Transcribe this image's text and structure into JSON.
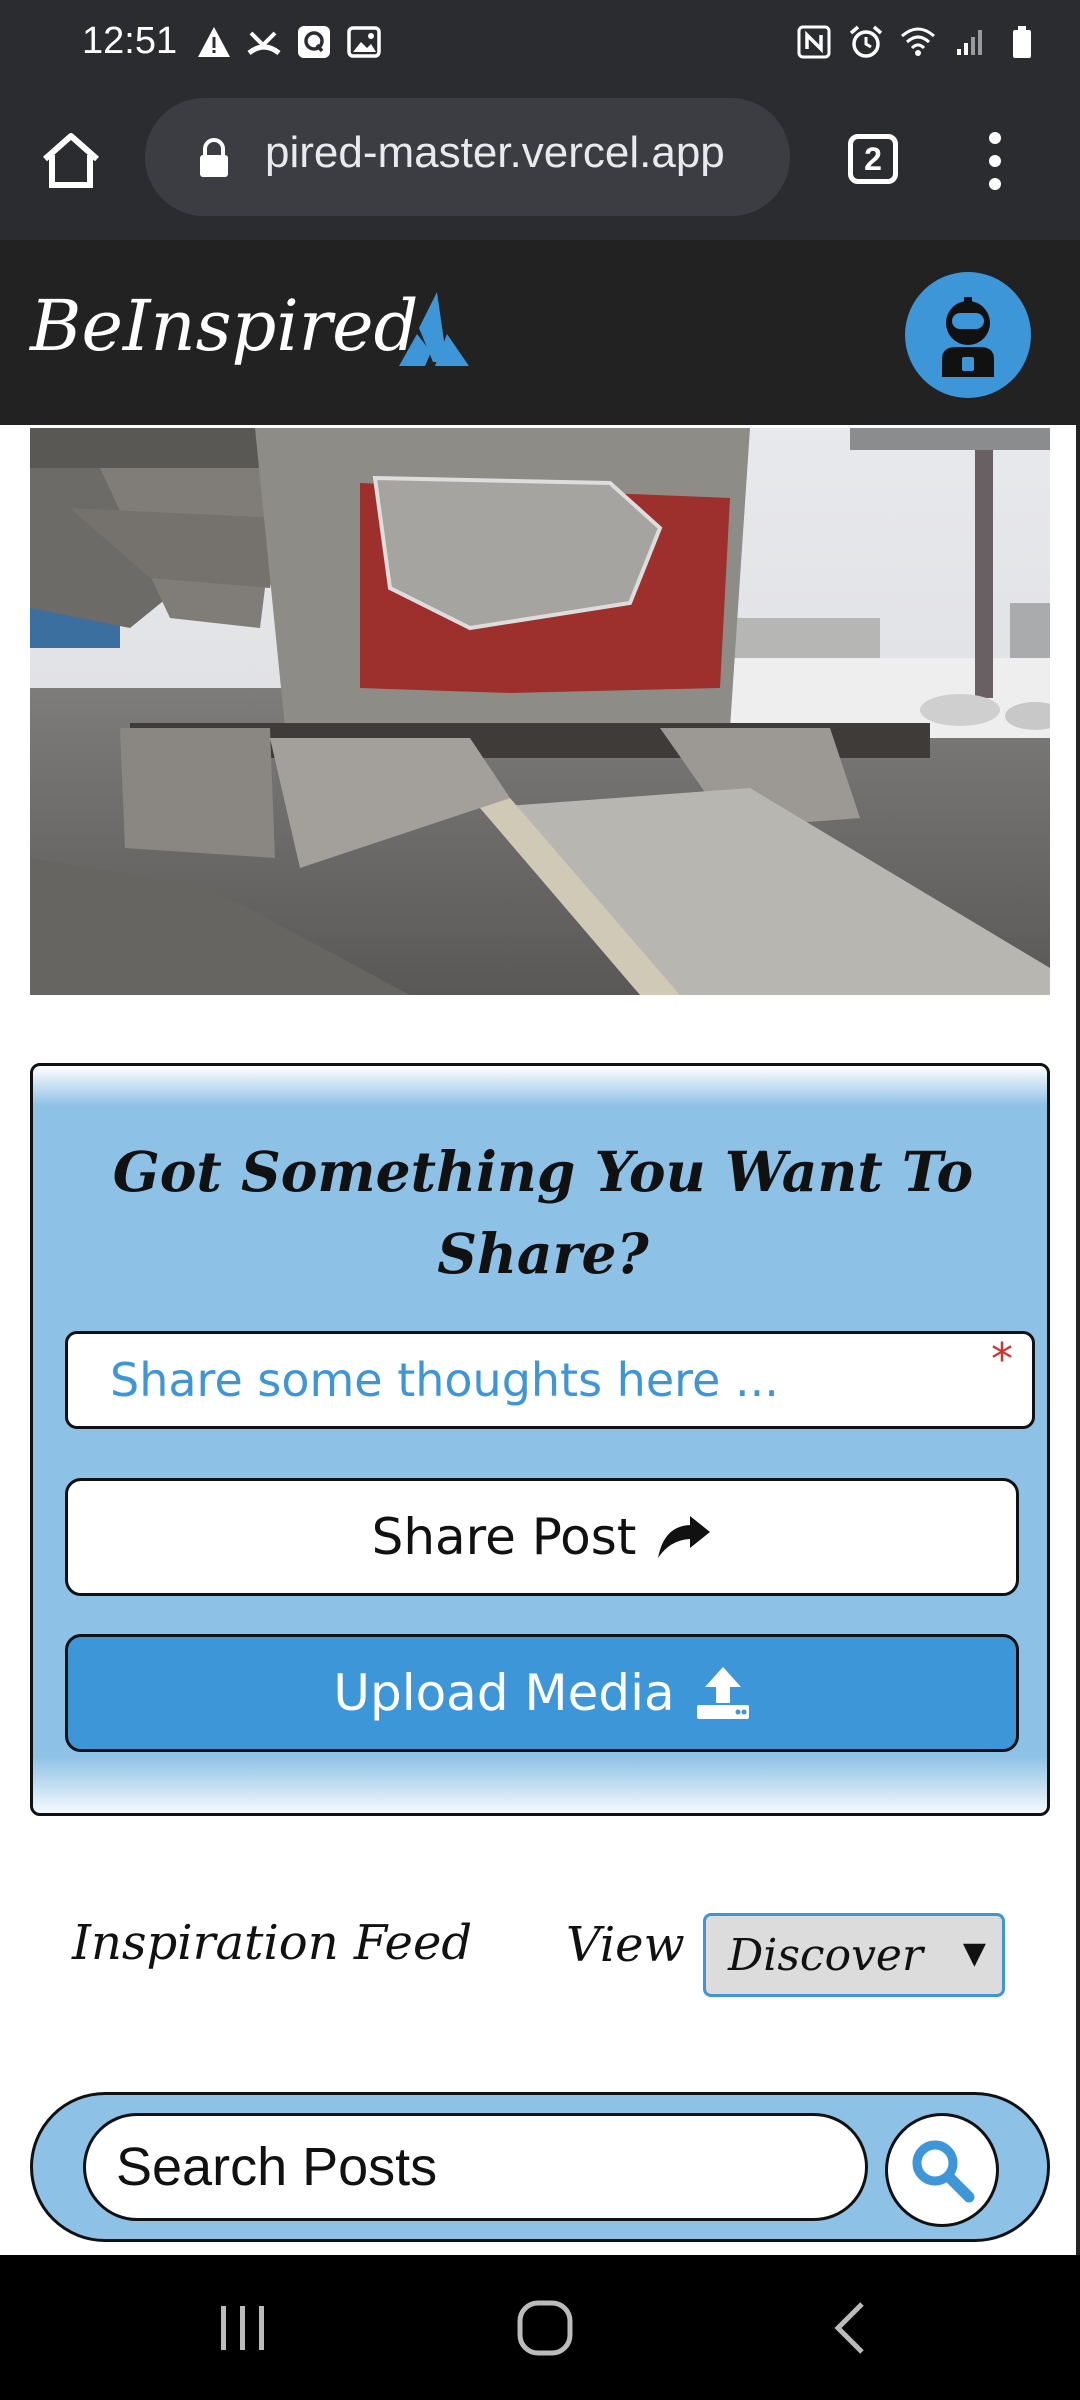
{
  "status_bar": {
    "time": "12:51"
  },
  "browser": {
    "url": "pired-master.vercel.app",
    "tab_count": "2"
  },
  "header": {
    "brand": "BeInspired"
  },
  "share": {
    "title": "Got Something You Want To Share?",
    "input_placeholder": "Share some thoughts here ...",
    "required_mark": "*",
    "share_button": "Share Post",
    "upload_button": "Upload Media"
  },
  "feed": {
    "label": "Inspiration Feed",
    "view_label": "View",
    "view_selected": "Discover"
  },
  "search": {
    "placeholder": "Search Posts"
  },
  "colors": {
    "accent": "#3d96d8",
    "panel": "#8ec1e6",
    "header": "#222222"
  }
}
